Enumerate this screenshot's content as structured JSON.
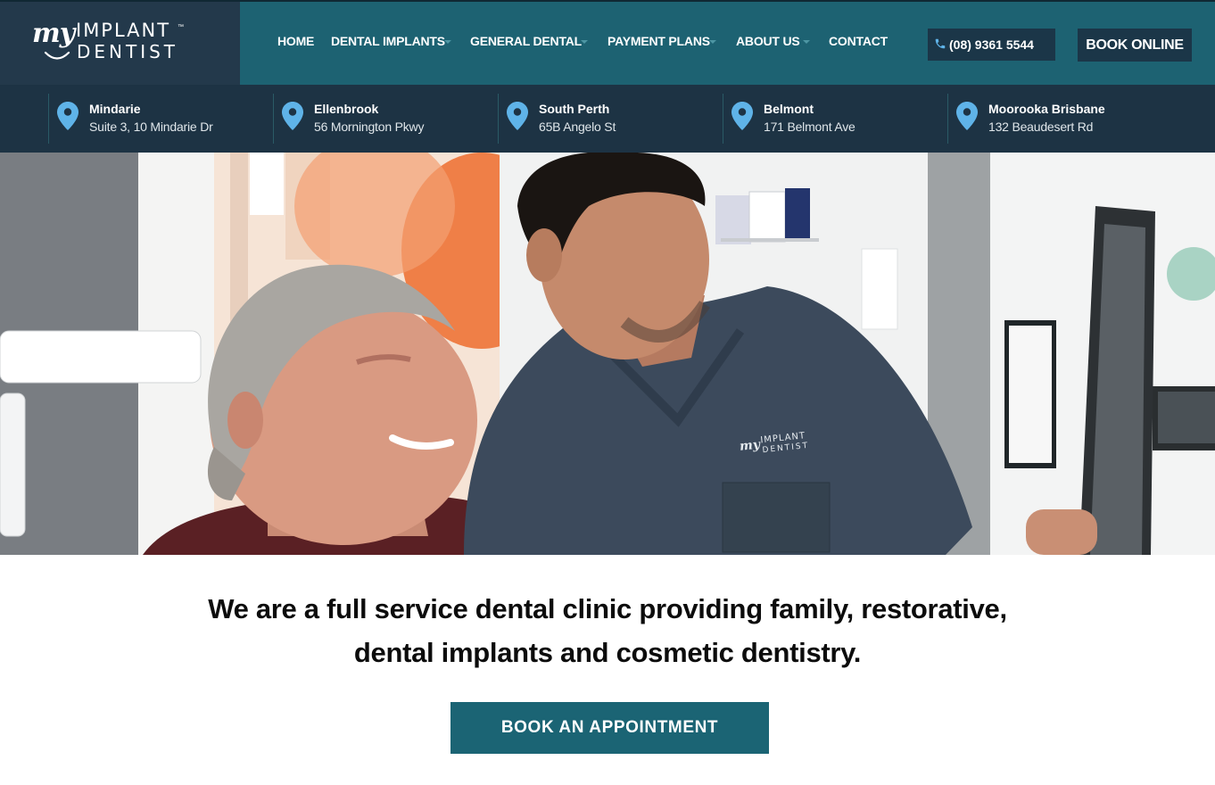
{
  "brand": {
    "logo_my": "my",
    "logo_implant": "IMPLANT",
    "logo_tm": "™",
    "logo_dentist": "DENTIST"
  },
  "nav": {
    "items": [
      {
        "label": "HOME",
        "dropdown": false
      },
      {
        "label": "DENTAL IMPLANTS",
        "dropdown": true
      },
      {
        "label": "GENERAL DENTAL",
        "dropdown": true
      },
      {
        "label": "PAYMENT PLANS",
        "dropdown": true
      },
      {
        "label": "ABOUT US",
        "dropdown": true
      },
      {
        "label": "CONTACT",
        "dropdown": false
      }
    ],
    "phone": "(08) 9361 5544",
    "book_online": "BOOK ONLINE"
  },
  "locations": [
    {
      "name": "Mindarie",
      "address": "Suite 3, 10 Mindarie Dr"
    },
    {
      "name": "Ellenbrook",
      "address": "56 Mornington Pkwy"
    },
    {
      "name": "South Perth",
      "address": "65B Angelo St"
    },
    {
      "name": "Belmont",
      "address": "171 Belmont Ave"
    },
    {
      "name": "Moorooka Brisbane",
      "address": "132 Beaudesert Rd"
    }
  ],
  "hero": {
    "scrub_logo_my": "my",
    "scrub_logo_implant": "IMPLANT",
    "scrub_logo_dentist": "DENTIST"
  },
  "intro": {
    "line1": "We are a full service dental clinic providing family, restorative,",
    "line2": "dental implants and cosmetic dentistry.",
    "cta": "BOOK AN APPOINTMENT"
  },
  "colors": {
    "header_teal": "#1d6272",
    "logo_panel": "#23394b",
    "location_bar": "#1d3344",
    "pin_blue": "#5fb3e8",
    "cta_teal": "#1b6474"
  },
  "icons": {
    "phone": "phone-icon",
    "location": "map-pin-icon",
    "dropdown": "caret-down-icon"
  }
}
